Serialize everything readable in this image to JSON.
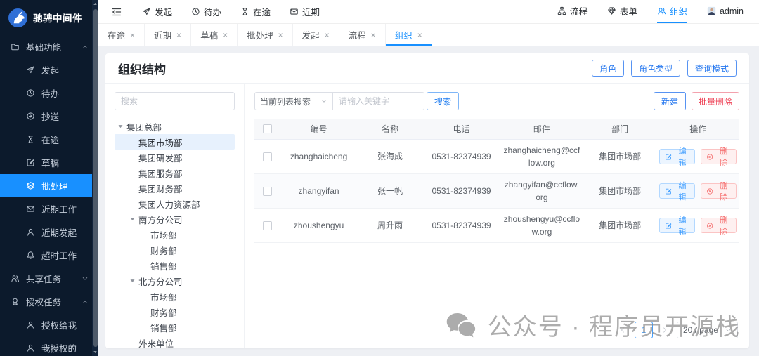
{
  "app": {
    "logo_text": "驰骋中间件"
  },
  "colors": {
    "accent": "#1890ff",
    "danger": "#f56c6c",
    "sidebar_bg": "#0c1a2c",
    "tree_selected_bg": "#e7f1fd"
  },
  "sidebar": {
    "items": [
      {
        "label": "基础功能",
        "icon": "folder",
        "group": true,
        "chev": "chevron-up"
      },
      {
        "label": "发起",
        "icon": "send",
        "sub": true
      },
      {
        "label": "待办",
        "icon": "clock",
        "sub": true
      },
      {
        "label": "抄送",
        "icon": "forward",
        "sub": true
      },
      {
        "label": "在途",
        "icon": "hourglass",
        "sub": true
      },
      {
        "label": "草稿",
        "icon": "edit-square",
        "sub": true
      },
      {
        "label": "批处理",
        "icon": "layers",
        "sub": true,
        "active": true
      },
      {
        "label": "近期工作",
        "icon": "mail",
        "sub": true
      },
      {
        "label": "近期发起",
        "icon": "user",
        "sub": true
      },
      {
        "label": "超时工作",
        "icon": "bell",
        "sub": true
      },
      {
        "label": "共享任务",
        "icon": "share-user",
        "group": true,
        "chev": "chevron-down"
      },
      {
        "label": "授权任务",
        "icon": "award",
        "group": true,
        "chev": "chevron-up"
      },
      {
        "label": "授权给我",
        "icon": "user",
        "sub": true
      },
      {
        "label": "我授权的",
        "icon": "user",
        "sub": true
      }
    ]
  },
  "topbar": {
    "quick": [
      {
        "label": "发起",
        "icon": "send"
      },
      {
        "label": "待办",
        "icon": "clock"
      },
      {
        "label": "在途",
        "icon": "hourglass"
      },
      {
        "label": "近期",
        "icon": "mail"
      }
    ],
    "right": [
      {
        "label": "流程",
        "icon": "flow"
      },
      {
        "label": "表单",
        "icon": "form"
      },
      {
        "label": "组织",
        "icon": "org",
        "active": true
      },
      {
        "label": "admin",
        "icon": "avatar"
      }
    ]
  },
  "tabs": {
    "close_glyph": "×",
    "items": [
      {
        "label": "在途"
      },
      {
        "label": "近期"
      },
      {
        "label": "草稿"
      },
      {
        "label": "批处理"
      },
      {
        "label": "发起"
      },
      {
        "label": "流程"
      },
      {
        "label": "组织",
        "active": true
      }
    ]
  },
  "page": {
    "title": "组织结构",
    "header_buttons": [
      "角色",
      "角色类型",
      "查询模式"
    ]
  },
  "tree": {
    "search_placeholder": "搜索",
    "nodes": [
      {
        "label": "集团总部",
        "level": 0,
        "caret": "caret-down"
      },
      {
        "label": "集团市场部",
        "level": 1,
        "selected": true
      },
      {
        "label": "集团研发部",
        "level": 1
      },
      {
        "label": "集团服务部",
        "level": 1
      },
      {
        "label": "集团财务部",
        "level": 1
      },
      {
        "label": "集团人力资源部",
        "level": 1
      },
      {
        "label": "南方分公司",
        "level": 1,
        "caret": "caret-down"
      },
      {
        "label": "市场部",
        "level": 2
      },
      {
        "label": "财务部",
        "level": 2
      },
      {
        "label": "销售部",
        "level": 2
      },
      {
        "label": "北方分公司",
        "level": 1,
        "caret": "caret-down"
      },
      {
        "label": "市场部",
        "level": 2
      },
      {
        "label": "财务部",
        "level": 2
      },
      {
        "label": "销售部",
        "level": 2
      },
      {
        "label": "外来单位",
        "level": 1
      }
    ]
  },
  "toolbar": {
    "scope_select": "当前列表搜索",
    "keyword_placeholder": "请输入关键字",
    "search_label": "搜索",
    "new_label": "新建",
    "batch_delete_label": "批量删除"
  },
  "table": {
    "columns": [
      "编号",
      "名称",
      "电话",
      "邮件",
      "部门",
      "操作"
    ],
    "edit_label": "编辑",
    "delete_label": "删除",
    "rows": [
      {
        "code": "zhanghaicheng",
        "name": "张海成",
        "phone": "0531-82374939",
        "email": "zhanghaicheng@ccflow.org",
        "dept": "集团市场部"
      },
      {
        "code": "zhangyifan",
        "name": "张一帆",
        "phone": "0531-82374939",
        "email": "zhangyifan@ccflow.org",
        "dept": "集团市场部"
      },
      {
        "code": "zhoushengyu",
        "name": "周升雨",
        "phone": "0531-82374939",
        "email": "zhoushengyu@ccflow.org",
        "dept": "集团市场部"
      }
    ]
  },
  "pagination": {
    "current": "1",
    "page_size": "20 / page"
  },
  "watermark": {
    "text": "公众号 · 程序员开源栈"
  }
}
